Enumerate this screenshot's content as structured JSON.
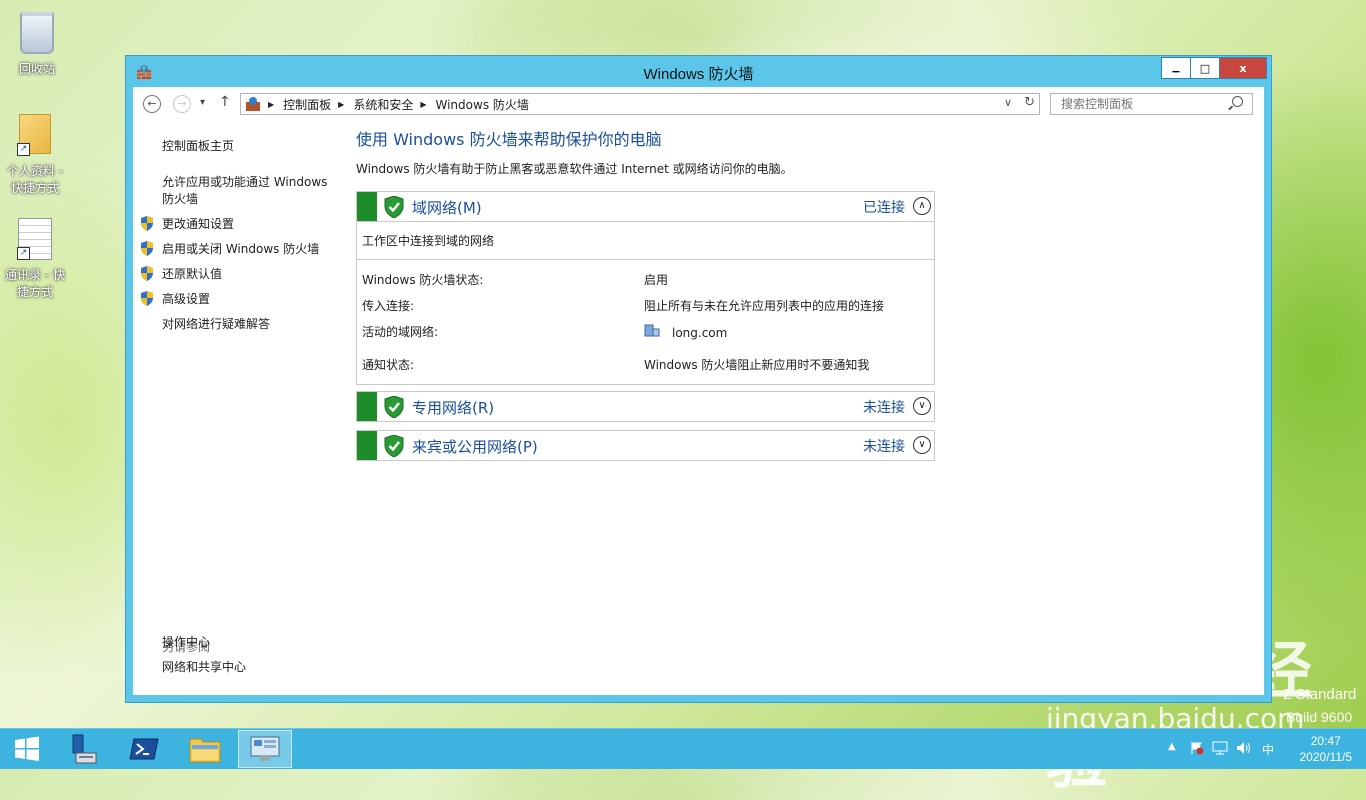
{
  "desktop": {
    "icons": [
      {
        "label": "回收站"
      },
      {
        "label": "个人资料 - 快捷方式"
      },
      {
        "label": "通讯录 - 快捷方式"
      }
    ]
  },
  "window": {
    "title": "Windows 防火墙",
    "controls": {
      "minimize": "▁",
      "maximize": "□",
      "close": "x"
    },
    "address": {
      "breadcrumbs": [
        "控制面板",
        "系统和安全",
        "Windows 防火墙"
      ]
    },
    "search": {
      "placeholder": "搜索控制面板"
    },
    "left_nav": {
      "items": [
        {
          "label": "控制面板主页",
          "shield": false
        },
        {
          "label": "允许应用或功能通过 Windows 防火墙",
          "shield": false
        },
        {
          "label": "更改通知设置",
          "shield": true
        },
        {
          "label": "启用或关闭 Windows 防火墙",
          "shield": true
        },
        {
          "label": "还原默认值",
          "shield": true
        },
        {
          "label": "高级设置",
          "shield": true
        },
        {
          "label": "对网络进行疑难解答",
          "shield": false
        }
      ],
      "see_also_heading": "另请参阅",
      "see_also": [
        "操作中心",
        "网络和共享中心"
      ]
    },
    "main": {
      "title": "使用 Windows 防火墙来帮助保护你的电脑",
      "description": "Windows 防火墙有助于防止黑客或恶意软件通过 Internet 或网络访问你的电脑。",
      "networks": [
        {
          "name": "域网络(M)",
          "status": "已连接",
          "expanded": true,
          "subtitle": "工作区中连接到域的网络",
          "details": [
            {
              "label": "Windows 防火墙状态:",
              "value": "启用"
            },
            {
              "label": "传入连接:",
              "value": "阻止所有与未在允许应用列表中的应用的连接"
            },
            {
              "label": "活动的域网络:",
              "value": "long.com"
            },
            {
              "label": "通知状态:",
              "value": "Windows 防火墙阻止新应用时不要通知我"
            }
          ]
        },
        {
          "name": "专用网络(R)",
          "status": "未连接",
          "expanded": false
        },
        {
          "name": "来宾或公用网络(P)",
          "status": "未连接",
          "expanded": false
        }
      ]
    }
  },
  "watermark": {
    "logo": "Baidu经验",
    "url": "jingyan.baidu.com",
    "edition_line1": "2 Standard",
    "edition_line2": "Build 9600"
  },
  "taskbar": {
    "items": [
      "start-button",
      "server-manager",
      "powershell",
      "file-explorer",
      "control-panel"
    ],
    "tray": {
      "ime": "中",
      "time": "20:47",
      "date": "2020/11/5"
    }
  },
  "colors": {
    "accent": "#5cc5ea",
    "link": "#1a4f9c",
    "shield_green": "#1f8c2a",
    "close": "#c7463d",
    "taskbar": "#3db3df"
  }
}
